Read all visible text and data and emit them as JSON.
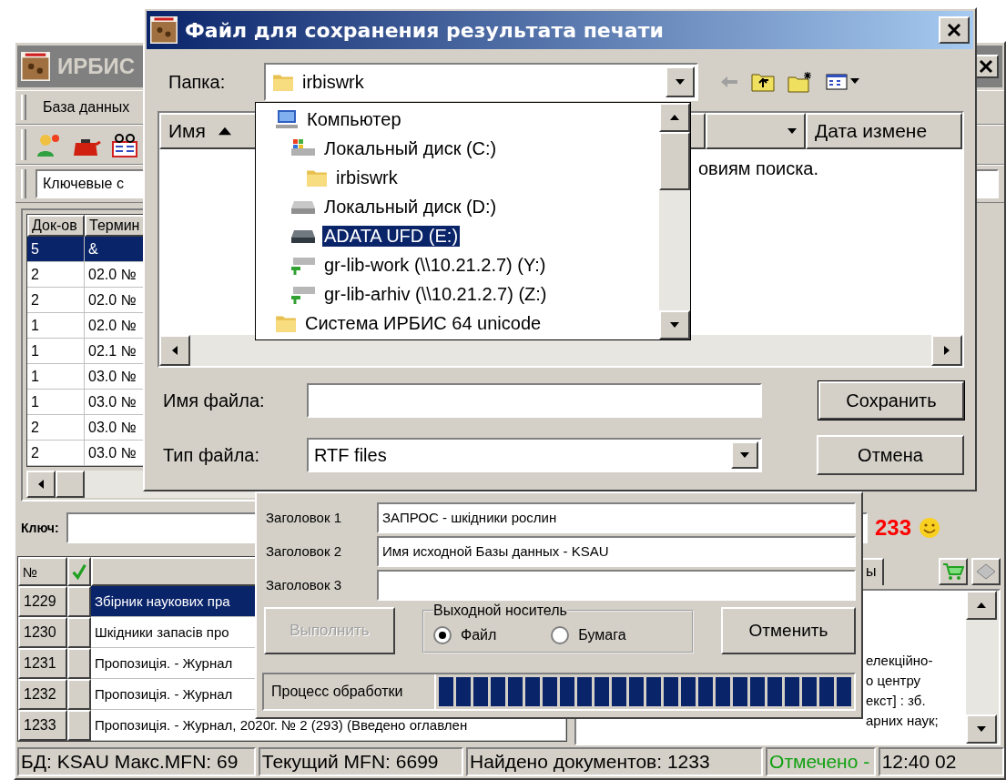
{
  "main_window": {
    "title": "ИРБИС",
    "menu": [
      "База данных"
    ],
    "search_combo": {
      "value": "Ключевые с"
    },
    "terms_table": {
      "columns": [
        "Док-ов",
        "Термин"
      ],
      "rows": [
        {
          "cells": [
            "5",
            "&"
          ],
          "selected": true
        },
        {
          "cells": [
            "2",
            "02.0 №"
          ],
          "selected": false
        },
        {
          "cells": [
            "2",
            "02.0 №"
          ],
          "selected": false
        },
        {
          "cells": [
            "1",
            "02.0 №"
          ],
          "selected": false
        },
        {
          "cells": [
            "1",
            "02.1 №"
          ],
          "selected": false
        },
        {
          "cells": [
            "1",
            "03.0 №"
          ],
          "selected": false
        },
        {
          "cells": [
            "1",
            "03.0 №"
          ],
          "selected": false
        },
        {
          "cells": [
            "2",
            "03.0 №"
          ],
          "selected": false
        },
        {
          "cells": [
            "2",
            "03.0 №"
          ],
          "selected": false
        }
      ]
    },
    "key_field": {
      "label": "Ключ:"
    },
    "found_count": "233",
    "docs_table": {
      "columns": [
        "№"
      ],
      "rows": [
        {
          "number": "1229",
          "checked": false,
          "title": "Збірник наукових пра",
          "selected": true
        },
        {
          "number": "1230",
          "checked": false,
          "title": "Шкідники запасів про",
          "selected": false
        },
        {
          "number": "1231",
          "checked": false,
          "title": "Пропозиція. - Журнал",
          "selected": false
        },
        {
          "number": "1232",
          "checked": false,
          "title": "Пропозиція. - Журнал",
          "selected": false
        },
        {
          "number": "1233",
          "checked": false,
          "title": "Пропозиція. - Журнал, 2020г. № 2 (293)  (Введено оглавлен",
          "selected": false
        }
      ]
    },
    "description_tab": "ы",
    "description_lines": [
      "елекційно-",
      "о центру",
      "екст] : зб.",
      "арних наук;"
    ],
    "status_bar": [
      {
        "text": "БД: KSAU Макс.MFN: 69",
        "kind": "normal"
      },
      {
        "text": "Текущий MFN: 6699",
        "kind": "normal"
      },
      {
        "text": "Найдено документов: 1233",
        "kind": "normal"
      },
      {
        "text": "Отмечено -",
        "kind": "marked"
      },
      {
        "text": "12:40  02",
        "kind": "normal"
      }
    ]
  },
  "print_dialog": {
    "headings": [
      {
        "label": "Заголовок 1",
        "value": "ЗАПРОС - шкідники рослин"
      },
      {
        "label": "Заголовок 2",
        "value": "Имя исходной Базы данных - KSAU"
      },
      {
        "label": "Заголовок 3"
      }
    ],
    "run_button": {
      "label": "Выполнить",
      "disabled": true
    },
    "output": {
      "label": "Выходной носитель",
      "options": [
        {
          "label": "Файл",
          "selected": true
        },
        {
          "label": "Бумага",
          "selected": false
        }
      ]
    },
    "cancel_button": "Отменить",
    "progress": {
      "label": "Процесс обработки",
      "level": 1
    }
  },
  "file_dialog": {
    "title": "Файл для сохранения результата печати",
    "folder": {
      "label": "Папка:",
      "value": "irbiswrk"
    },
    "list": {
      "columns": [
        "Имя",
        "Дата измене"
      ],
      "message": "овиям поиска."
    },
    "file_name": {
      "label": "Имя файла:"
    },
    "file_type": {
      "label": "Тип файла:",
      "value": "RTF files"
    },
    "buttons": [
      "Сохранить",
      "Отмена"
    ],
    "folder_dropdown": [
      {
        "label": "Компьютер",
        "kind": "computer",
        "selected": false,
        "children": [
          {
            "label": "Локальный диск (C:)",
            "kind": "system-disk",
            "selected": false,
            "children": [
              {
                "label": "irbiswrk",
                "kind": "folder",
                "selected": false
              }
            ]
          },
          {
            "label": "Локальный диск (D:)",
            "kind": "disk",
            "selected": false
          },
          {
            "label": "ADATA UFD (E:)",
            "kind": "usb",
            "selected": true
          },
          {
            "label": "gr-lib-work (\\\\10.21.2.7) (Y:)",
            "kind": "network",
            "selected": false
          },
          {
            "label": "gr-lib-arhiv (\\\\10.21.2.7) (Z:)",
            "kind": "network",
            "selected": false
          }
        ]
      },
      {
        "label": "Система ИРБИС 64 unicode",
        "kind": "folder",
        "selected": false
      }
    ]
  }
}
